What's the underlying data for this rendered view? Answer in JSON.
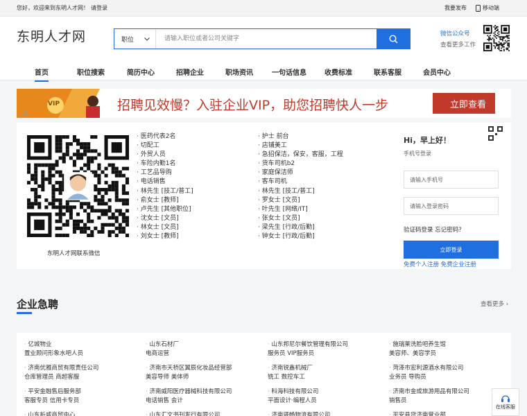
{
  "topbar": {
    "greeting": "您好，欢迎来到东明人才网！",
    "login": "请登录",
    "post": "我要发布",
    "mobile": "移动端"
  },
  "header": {
    "logo": "东明人才网",
    "search_type": "职位",
    "search_placeholder": "请输入职位或者公司关键字",
    "wechat": "微信公众号",
    "more_work": "查看更多工作"
  },
  "nav": [
    "首页",
    "职位搜索",
    "简历中心",
    "招聘企业",
    "职场资讯",
    "一句话信息",
    "收费标准",
    "联系客服",
    "会员中心"
  ],
  "banner": {
    "text": "招聘见效慢？入驻企业VIP，助您招聘快人一步",
    "button": "立即查看",
    "ad": "广告",
    "badge": "VIP"
  },
  "main": {
    "qr_caption": "东明人才网联系微信",
    "col1": [
      "医药代表2名",
      "切配工",
      "外贸人员",
      "车险内勤1名",
      "工艺品导购",
      "电话销售",
      "林先生 [技工/普工]",
      "俞女士 [教师]",
      "卢先生 [其他职位]",
      "沈女士 [文员]",
      "林女士 [文员]",
      "刘女士 [教师]"
    ],
    "col2": [
      "护士 前台",
      "店铺美工",
      "急招保洁，保安，客服，工程",
      "货车司机b2",
      "家庭保洁师",
      "客车司机",
      "林先生 [技工/普工]",
      "罗女士 [文员]",
      "叶先生 [网络/IT]",
      "张女士 [文员]",
      "梁先生 [行政/后勤]",
      "钟女士 [行政/后勤]"
    ]
  },
  "login": {
    "title": "Hi，早上好！",
    "subtitle": "手机号登录",
    "phone_placeholder": "请输入手机号",
    "pwd_placeholder": "请输入登录密码",
    "code_login": "验证码登录",
    "forgot": "忘记密码？",
    "submit": "立即登录",
    "reg_personal": "免费个人注册",
    "reg_company": "免费企业注册"
  },
  "section": {
    "title": "企业急聘",
    "more": "查看更多"
  },
  "jobs": [
    {
      "company": "亿城物业",
      "positions": "置业顾问形象水吧人员"
    },
    {
      "company": "山东石材厂",
      "positions": "电商运营"
    },
    {
      "company": "山东邦尼尔餐饮管理有限公司",
      "positions": "服务员 VIP服务员"
    },
    {
      "company": "施瑞莱洗脸吧养生馆",
      "positions": "美容师、美容学员"
    },
    {
      "company": "济南优雅商贸有限责任公司",
      "positions": "仓库管理员 商超客服"
    },
    {
      "company": "济南市天桥区翼辰化妆品经营部",
      "positions": "美容导师 美体师"
    },
    {
      "company": "济南锐鑫机械厂",
      "positions": "铣工 数控车工"
    },
    {
      "company": "菏泽市宏利源酒水有限公司",
      "positions": "业务员 导购员"
    },
    {
      "company": "平安金融售后服务部",
      "positions": "客服专员 信用卡专员"
    },
    {
      "company": "济南威阳医疗器械科技有限公司",
      "positions": "电话销售 会计"
    },
    {
      "company": "科海科技有限公司",
      "positions": "平面设计·编程人员"
    },
    {
      "company": "济南市金成旅游用品有限公司",
      "positions": "销售员"
    },
    {
      "company": "山东析威商贸中心",
      "positions": ""
    },
    {
      "company": "山东汇文书刊发行有限公司",
      "positions": ""
    },
    {
      "company": "济南驿畅物流有限公司",
      "positions": ""
    },
    {
      "company": "平安县贷济南营业部",
      "positions": ""
    }
  ],
  "service": "在线客服",
  "colors": {
    "accent": "#1f6fe0",
    "banner_red": "#d8261c"
  }
}
